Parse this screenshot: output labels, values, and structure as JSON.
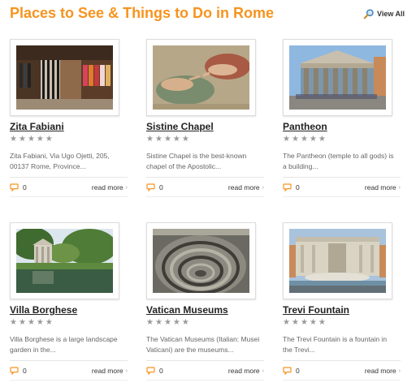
{
  "header": {
    "title": "Places to See & Things to Do in Rome",
    "view_all": "View All"
  },
  "colors": {
    "accent": "#f7931e",
    "star": "#9a9a9a"
  },
  "places": [
    {
      "title": "Zita Fabiani",
      "rating": 0,
      "description": "Zita Fabiani, Via Ugo Ojetti, 205, 00137 Rome, Province...",
      "comments": "0",
      "read_more": "read more",
      "image_icon": "clothing-store-photo"
    },
    {
      "title": "Sistine Chapel",
      "rating": 0,
      "description": "Sistine Chapel is the best-known chapel of the Apostolic...",
      "comments": "0",
      "read_more": "read more",
      "image_icon": "ceiling-fresco-photo"
    },
    {
      "title": "Pantheon",
      "rating": 0,
      "description": "The Pantheon (temple to all gods) is a building...",
      "comments": "0",
      "read_more": "read more",
      "image_icon": "temple-facade-photo"
    },
    {
      "title": "Villa Borghese",
      "rating": 0,
      "description": "Villa Borghese is a large landscape garden in the...",
      "comments": "0",
      "read_more": "read more",
      "image_icon": "garden-lake-photo"
    },
    {
      "title": "Vatican Museums",
      "rating": 0,
      "description": "The Vatican Museums (Italian: Musei Vaticani) are the museums...",
      "comments": "0",
      "read_more": "read more",
      "image_icon": "spiral-staircase-photo"
    },
    {
      "title": "Trevi Fountain",
      "rating": 0,
      "description": "The Trevi Fountain is a fountain in the Trevi...",
      "comments": "0",
      "read_more": "read more",
      "image_icon": "fountain-photo"
    }
  ]
}
